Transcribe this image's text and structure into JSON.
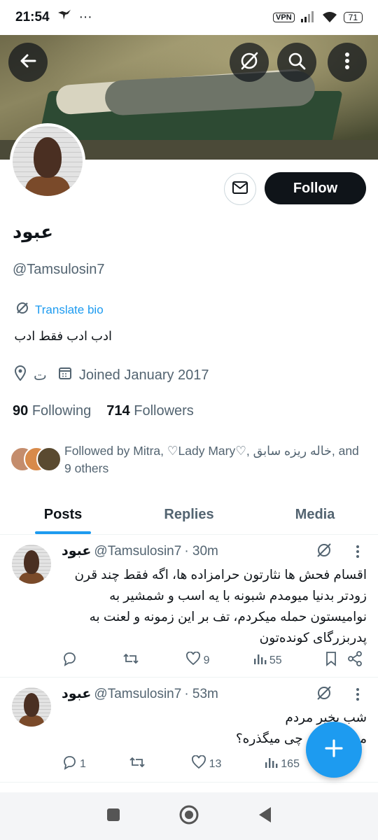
{
  "status_bar": {
    "time": "21:54",
    "overflow": "···",
    "vpn": "VPN",
    "battery": "71"
  },
  "header": {
    "back_icon": "arrow-left-icon",
    "grok_icon": "grok-icon",
    "search_icon": "search-icon",
    "more_icon": "more-vertical-icon"
  },
  "profile": {
    "name": "عبود",
    "handle": "@Tamsulosin7",
    "translate_bio": "Translate bio",
    "bio": "ادب ادب فقط ادب",
    "location": "ت",
    "joined": "Joined January 2017",
    "following_count": "90",
    "following_label": "Following",
    "followers_count": "714",
    "followers_label": "Followers",
    "followed_by": "Followed by Mitra, ♡Lady Mary♡, خاله ریزه سابق, and 9 others",
    "follow_button": "Follow"
  },
  "tabs": [
    {
      "label": "Posts",
      "active": true
    },
    {
      "label": "Replies",
      "active": false
    },
    {
      "label": "Media",
      "active": false
    }
  ],
  "posts": [
    {
      "name": "عبود",
      "handle": "@Tamsulosin7",
      "time": "· 30m",
      "text": "اقسام فحش ها نثارتون حرامزاده ها، اگه فقط چند قرن زودتر بدنیا میومدم شبونه با یه اسب و شمشیر به نوامیستون حمله میکردم، تف بر این زمونه و لعنت به پدربزرگای کونده‌تون",
      "replies": "",
      "reposts": "",
      "likes": "9",
      "views": "55"
    },
    {
      "name": "عبود",
      "handle": "@Tamsulosin7",
      "time": "· 53m",
      "text": "شب بخیر مردم\nمن تو سرم چی میگذره؟",
      "replies": "1",
      "reposts": "",
      "likes": "13",
      "views": "165"
    }
  ],
  "fab": {
    "icon": "plus-icon"
  },
  "nav": {
    "recents_icon": "square-icon",
    "home_icon": "circle-icon",
    "back_icon": "triangle-back-icon"
  },
  "colors": {
    "accent": "#1d9bf0",
    "text": "#0f1419",
    "muted": "#536471"
  }
}
